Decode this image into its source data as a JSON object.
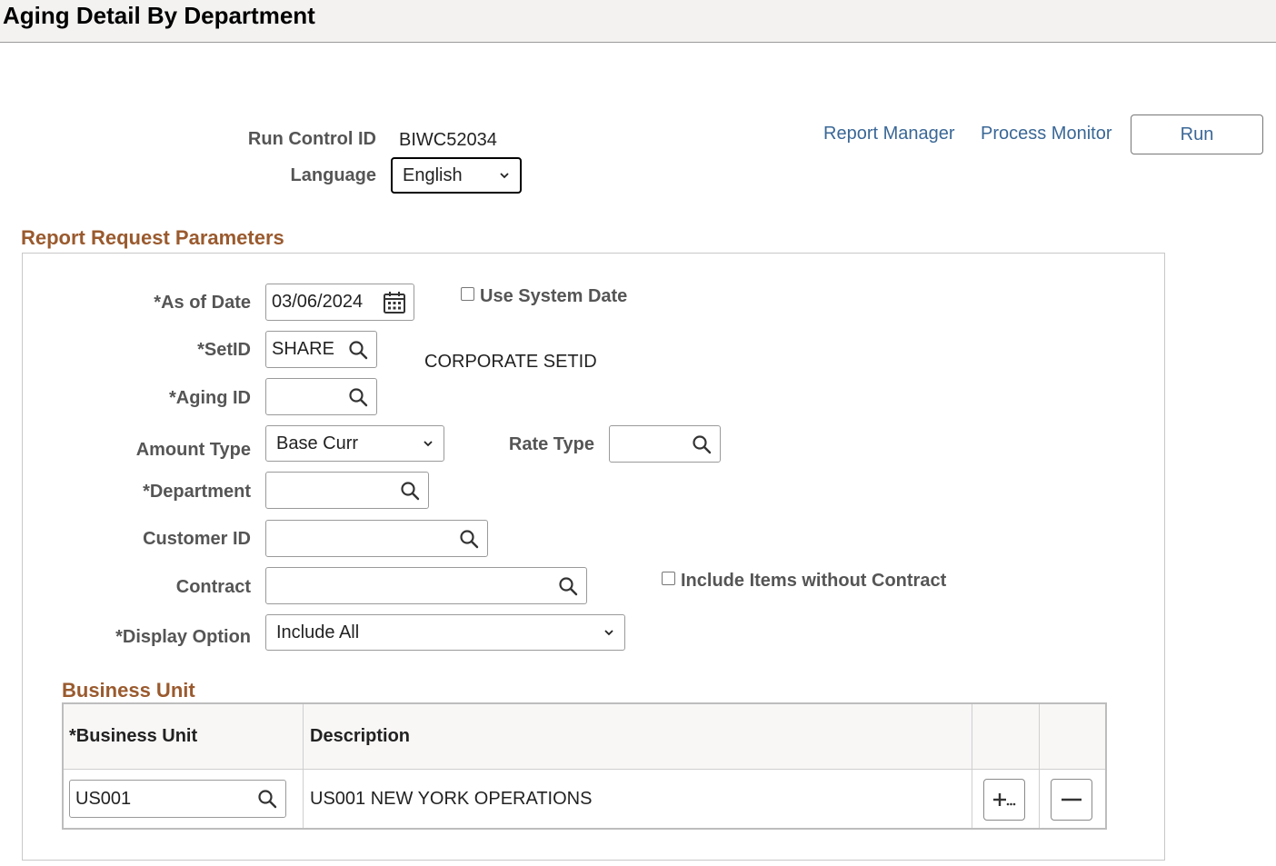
{
  "header": {
    "title": "Aging Detail By Department"
  },
  "run_control": {
    "run_control_id_label": "Run Control ID",
    "run_control_id_value": "BIWC52034",
    "language_label": "Language",
    "language_value": "English"
  },
  "toolbar": {
    "report_manager": "Report Manager",
    "process_monitor": "Process Monitor",
    "run": "Run"
  },
  "report_params": {
    "section_title": "Report Request Parameters",
    "as_of_date_label": "*As of Date",
    "as_of_date_value": "03/06/2024",
    "use_system_date_label": "Use System Date",
    "setid_label": "*SetID",
    "setid_value": "SHARE",
    "setid_description": "CORPORATE SETID",
    "aging_id_label": "*Aging ID",
    "aging_id_value": "",
    "amount_type_label": "Amount Type",
    "amount_type_value": "Base Curr",
    "rate_type_label": "Rate Type",
    "rate_type_value": "",
    "department_label": "*Department",
    "department_value": "",
    "customer_id_label": "Customer ID",
    "customer_id_value": "",
    "contract_label": "Contract",
    "contract_value": "",
    "include_without_contract_label": "Include Items without Contract",
    "display_option_label": "*Display Option",
    "display_option_value": "Include All"
  },
  "business_unit": {
    "section_title": "Business Unit",
    "columns": [
      "*Business Unit",
      "Description"
    ],
    "rows": [
      {
        "business_unit": "US001",
        "description": "US001 NEW YORK OPERATIONS"
      }
    ]
  },
  "colors": {
    "link": "#3a6796",
    "section_heading": "#9a5a2e",
    "label": "#555555"
  }
}
